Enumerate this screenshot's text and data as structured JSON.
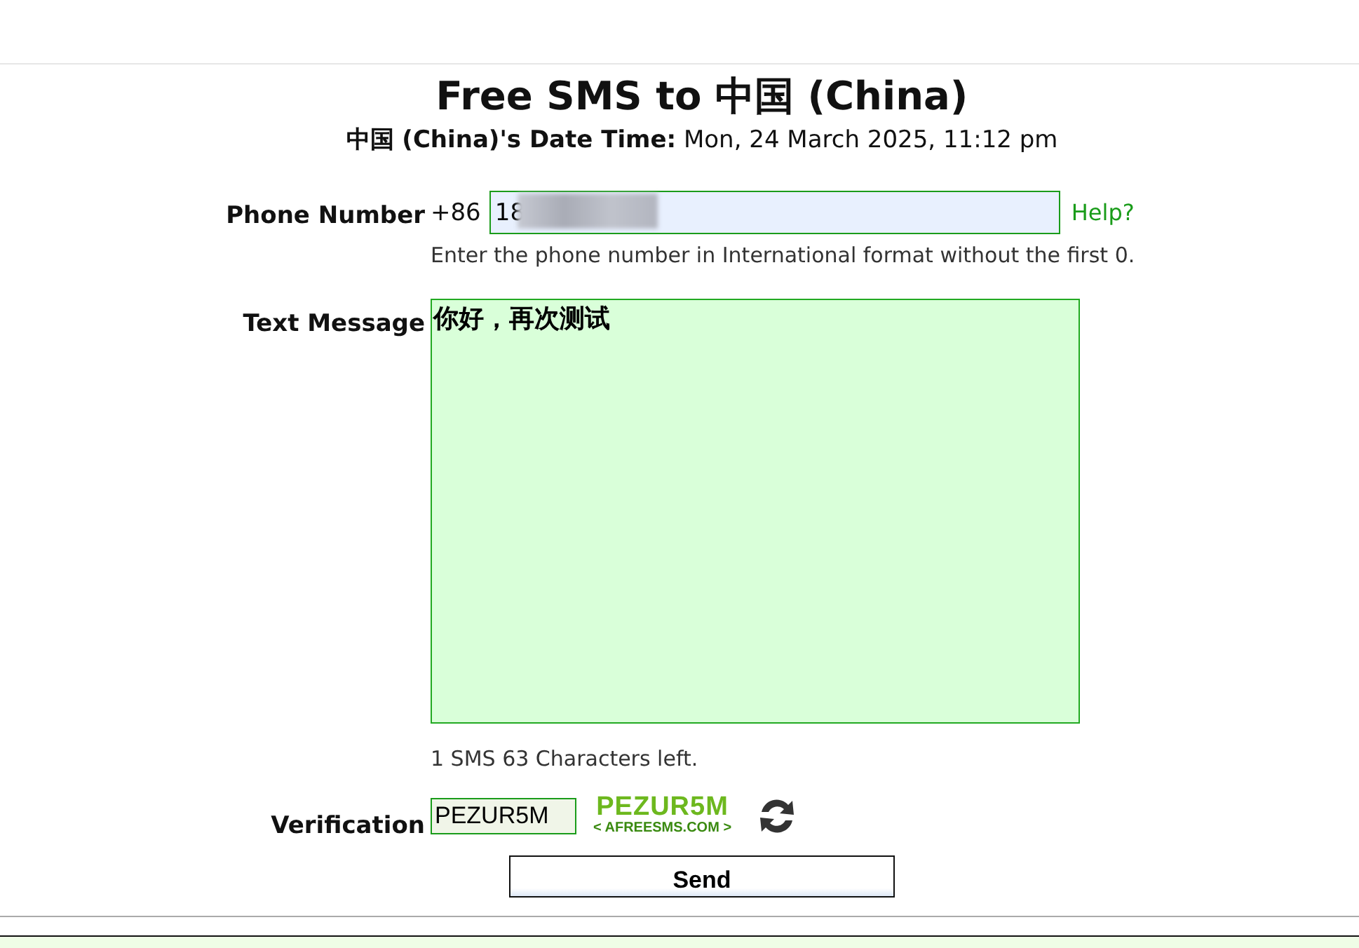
{
  "title": "Free SMS to 中国 (China)",
  "datetime": {
    "label": "中国 (China)'s Date Time:",
    "value": "Mon, 24 March 2025, 11:12 pm"
  },
  "phone": {
    "label": "Phone Number",
    "prefix": "+86",
    "value": "18",
    "redacted": true,
    "help": "Help?",
    "hint": "Enter the phone number in International format without the first 0."
  },
  "message": {
    "label": "Text Message",
    "value": "你好，再次测试",
    "counter": "1 SMS 63 Characters left."
  },
  "verification": {
    "label": "Verification",
    "value": "PEZUR5M",
    "captcha": {
      "code": "PEZUR5M",
      "site": "< AFREESMS.COM >"
    }
  },
  "send": "Send"
}
